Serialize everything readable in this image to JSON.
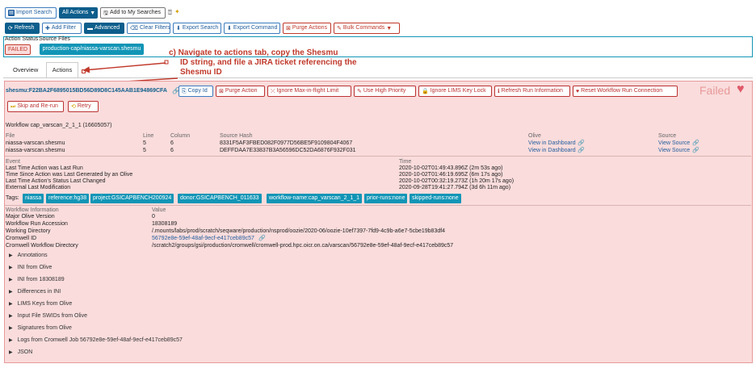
{
  "toolbar1": {
    "import_search": "Import Search",
    "all_actions": "All Actions",
    "add_to_searches": "Add to My Searches"
  },
  "toolbar2": {
    "refresh": "Refresh",
    "add_filter": "Add Filter",
    "advanced": "Advanced",
    "clear_filters": "Clear Filters",
    "export_search": "Export Search",
    "export_command": "Export Command",
    "purge_actions": "Purge Actions",
    "bulk_commands": "Bulk Commands"
  },
  "status_table": {
    "col_action_status": "Action Status",
    "col_source_files": "Source Files",
    "status": "FAILED",
    "source_file": "production-cap/niassa-varscan.shesmu"
  },
  "annotation": {
    "line1": "c) Navigate to actions tab, copy the Shesmu",
    "line2": "ID string, and file a JIRA ticket referencing the",
    "line3": "Shesmu ID"
  },
  "tabs": {
    "overview": "Overview",
    "actions": "Actions"
  },
  "action": {
    "shesmu_id": "shesmu:F22BA2F6895015BD56D89D8C145AAB1E94869CFA",
    "copy_id": "Copy Id",
    "purge_action": "Purge Action",
    "ignore_max_inflight": "Ignore Max-in-flight Limit",
    "use_high_priority": "Use High Priority",
    "ignore_lims_key_lock": "Ignore LIMS Key Lock",
    "refresh_run_info": "Refresh Run Information",
    "reset_workflow_conn": "Reset Workflow Run Connection",
    "skip_and_rerun": "Skip and Re-run",
    "retry": "Retry",
    "state": "Failed",
    "workflow_title": "Workflow cap_varscan_2_1_1 (16605057)"
  },
  "files_table": {
    "headers": [
      "File",
      "Line",
      "Column",
      "Source Hash",
      "Olive",
      "Source"
    ],
    "rows": [
      [
        "niassa-varscan.shesmu",
        "5",
        "6",
        "8331F5AF3FBED082F0977D56BE5F9109804F4067",
        "View in Dashboard",
        "View Source"
      ],
      [
        "niassa-varscan.shesmu",
        "5",
        "6",
        "DEFFDAA7E33837B3A56596DC52DA6876F932F031",
        "View in Dashboard",
        "View Source"
      ]
    ]
  },
  "events": {
    "headers": [
      "Event",
      "Time"
    ],
    "rows": [
      [
        "Last Time Action was Last Run",
        "2020-10-02T01:49:43.896Z (2m 53s ago)"
      ],
      [
        "Time Since Action was Last Generated by an Olive",
        "2020-10-02T01:46:19.695Z (6m 17s ago)"
      ],
      [
        "Last Time Action's Status Last Changed",
        "2020-10-02T00:32:19.273Z (1h 20m 17s ago)"
      ],
      [
        "External Last Modification",
        "2020-09-28T19:41:27.794Z (3d 6h 11m ago)"
      ]
    ]
  },
  "tags": {
    "label": "Tags:",
    "items": [
      "niassa",
      "reference:hg38",
      "project:GSICAPBENCH200924",
      "donor:GSICAPBENCH_011633",
      "workflow-name:cap_varscan_2_1_1",
      "prior-runs:none",
      "skipped-runs:none"
    ]
  },
  "workflow_info": {
    "headers": [
      "Workflow Information",
      "Value"
    ],
    "rows": [
      [
        "Major Olive Version",
        "0"
      ],
      [
        "Workflow Run Accession",
        "18308189"
      ],
      [
        "Working Directory",
        "/.mounts/labs/prod/scratch/seqware/production/nsprod/oozie/2020-06/oozie-10ef7397-7fd9-4c9b-a6e7-5cbe19b83df4"
      ],
      [
        "Cromwell ID",
        "56792e8e-59ef-48af-9ecf-e417ceb89c57"
      ],
      [
        "Cromwell Workflow Directory",
        "/scratch2/groups/gsi/production/cromwell/cromwell-prod.hpc.oicr.on.ca/varscan/56792e8e-59ef-48af-9ecf-e417ceb89c57"
      ]
    ]
  },
  "sections": [
    "Annotations",
    "INI from Olive",
    "INI from 18308189",
    "Differences in INI",
    "LIMS Keys from Olive",
    "Input File SWIDs from Olive",
    "Signatures from Olive",
    "Logs from Cromwell Job 56792e8e-59ef-48af-9ecf-e417ceb89c57",
    "JSON"
  ],
  "colors": {
    "failed_bg": "#fadcdc",
    "failed_border": "#e79a9a",
    "accent_blue": "#1295b6",
    "brand_dark": "#0d5e8c",
    "annotation_red": "#c0392b"
  }
}
